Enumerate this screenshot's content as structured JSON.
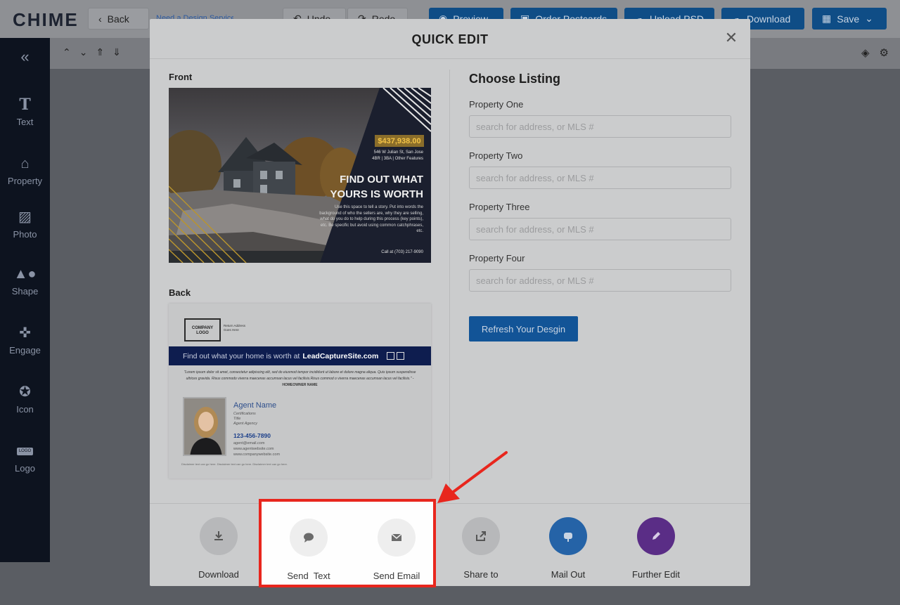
{
  "app": {
    "logo": "CHIME",
    "back_label": "Back",
    "need_service_link": "Need a Design Service",
    "undo_label": "Undo",
    "redo_label": "Redo",
    "preview_label": "Preview",
    "order_label": "Order Postcards",
    "upload_label": "Upload PSD",
    "download_label": "Download",
    "save_label": "Save"
  },
  "sidebar": {
    "items": [
      {
        "label": "Text",
        "icon": "text-icon"
      },
      {
        "label": "Property",
        "icon": "house-icon"
      },
      {
        "label": "Photo",
        "icon": "photo-icon"
      },
      {
        "label": "Shape",
        "icon": "shape-icon"
      },
      {
        "label": "Engage",
        "icon": "engage-icon"
      },
      {
        "label": "Icon",
        "icon": "star-icon"
      },
      {
        "label": "Logo",
        "icon": "logo-icon"
      }
    ],
    "logo_badge": "LOGO"
  },
  "modal": {
    "title": "QUICK EDIT",
    "front_label": "Front",
    "back_label": "Back",
    "front_card": {
      "price": "$437,938.00",
      "address": "546 W Julian St, San Jose",
      "features": "4BR | 3BA | Other Features",
      "headline_1": "FIND OUT WHAT",
      "headline_2": "YOURS IS WORTH",
      "body": "Use this space to tell a story. Put into words the background of who the sellers are, why they are selling, what do you do to help during this process (key points), etc. Be specific but avoid using common catchphrases, etc.",
      "call": "Call at (703) 217-9090"
    },
    "back_card": {
      "company_logo": "COMPANY LOGO",
      "return_address_1": "Return Address",
      "return_address_2": "Goes Here",
      "banner_prefix": "Find out what your home is worth at ",
      "banner_site": "LeadCaptureSite.com",
      "quote": "\"Lorem ipsum dolor sit amet, consectetur adipiscing elit, sed do eiusmod tempor incididunt ut labore et dolore magna aliqua. Quis ipsum suspendisse ultrices gravida. Risus commodo viverra maecenas accumsan lacus vel facilisis.Risus commod o viverra maecenas accumsan lacus vel facilisis.\" -",
      "quote_author": "HOMEOWNER NAME",
      "agent_name": "Agent Name",
      "certifications": "Certifications",
      "agent_title": "Title",
      "agency": "Agent Agency",
      "phone": "123-456-7890",
      "email": "agent@email.com",
      "agent_site": "www.agentwebsite.com",
      "company_site": "www.companywebsite.com",
      "disclaimer": "Disclaimer text can go here. Disclaimer text can go here. Disclaimer text can go here."
    },
    "choose_title": "Choose Listing",
    "properties": [
      {
        "label": "Property One",
        "placeholder": "search for address, or MLS #"
      },
      {
        "label": "Property Two",
        "placeholder": "search for address, or MLS #"
      },
      {
        "label": "Property Three",
        "placeholder": "search for address, or MLS #"
      },
      {
        "label": "Property Four",
        "placeholder": "search for address, or MLS #"
      }
    ],
    "refresh_label": "Refresh Your Desgin",
    "actions": {
      "download": "Download",
      "send_text": "Send  Text",
      "send_email": "Send Email",
      "share": "Share to",
      "mail_out": "Mail Out",
      "further_edit": "Further Edit"
    }
  },
  "colors": {
    "highlight": "#e8261d",
    "primary_blue": "#125497",
    "mail_out": "#2563a7",
    "further_edit": "#5a2d86"
  }
}
